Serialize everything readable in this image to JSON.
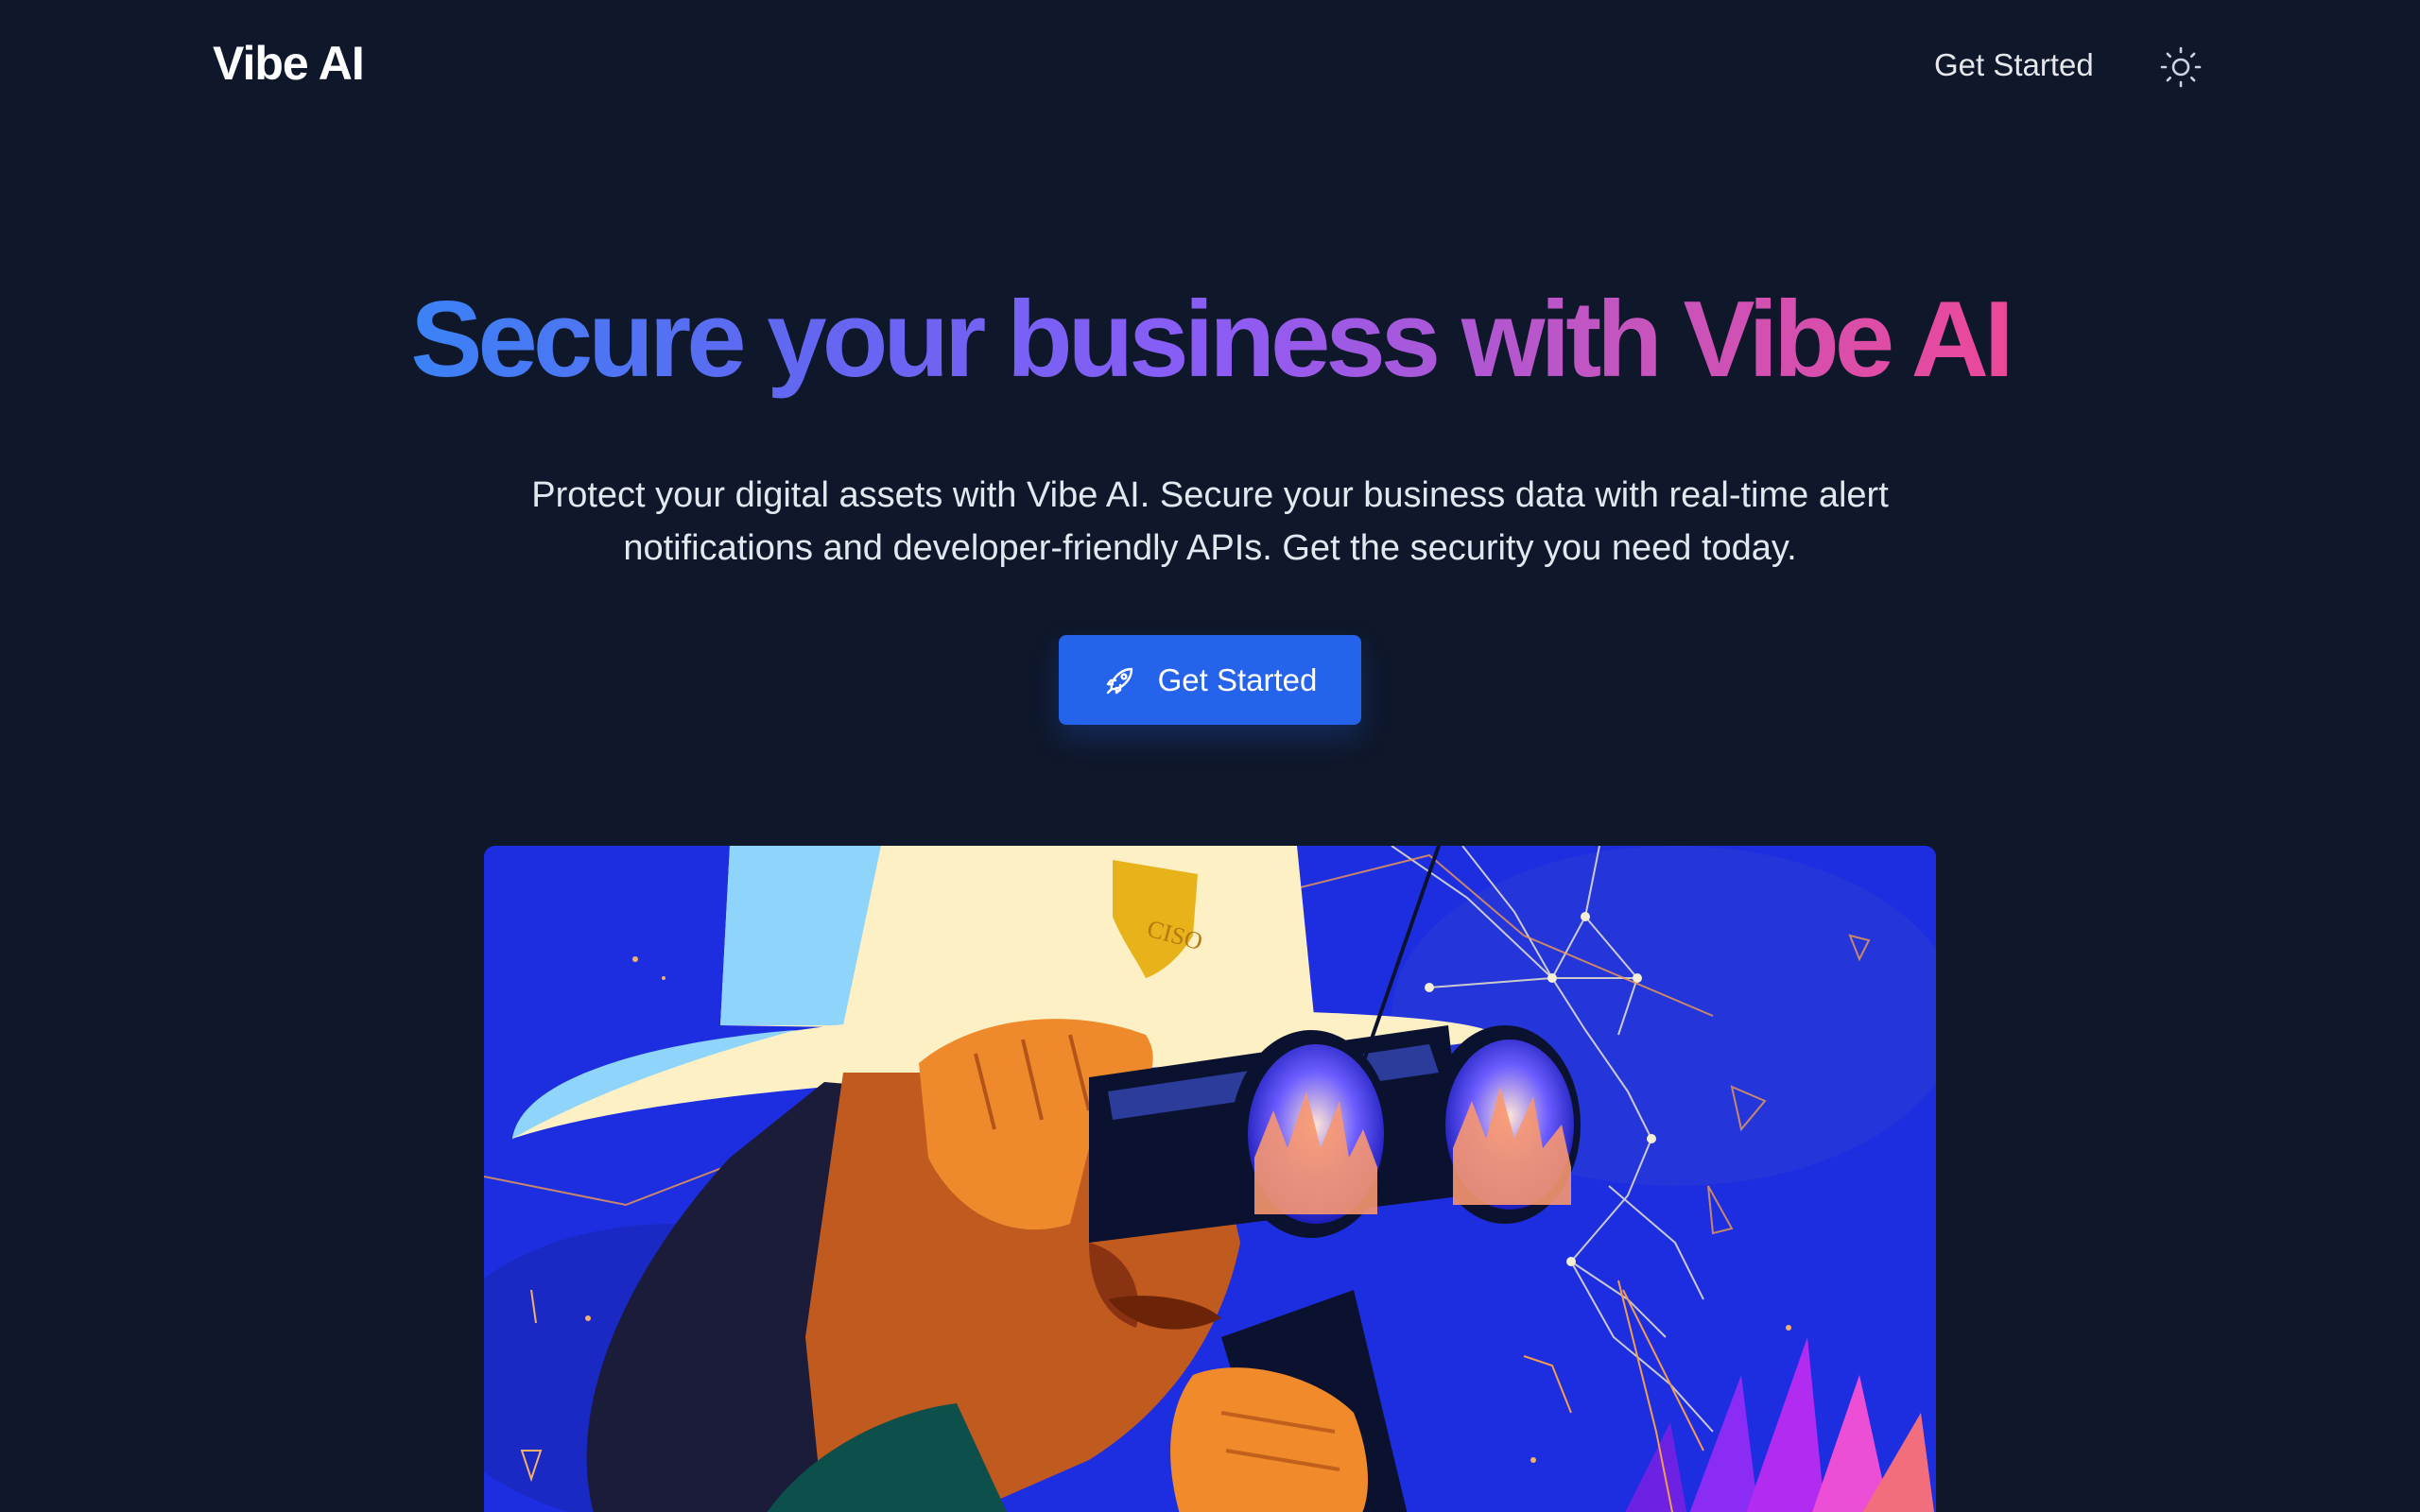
{
  "header": {
    "brand": "Vibe AI",
    "nav_get_started": "Get Started",
    "theme_toggle_icon": "sun-icon"
  },
  "hero": {
    "title": "Secure your business with Vibe AI",
    "gradient_colors": [
      "#3b82f6",
      "#6366f1",
      "#8b5cf6",
      "#c355c0",
      "#ec4899"
    ],
    "subtitle_line1": "Protect your digital assets with Vibe AI. Secure your business data with real-time alert",
    "subtitle_line2": "notifications and developer-friendly APIs. Get the security you need today.",
    "cta_label": "Get Started",
    "cta_icon": "rocket-icon",
    "cta_color": "#2563eb"
  },
  "illustration": {
    "badge_text": "CISO",
    "icon": "binoculars-illustration"
  },
  "colors": {
    "background": "#0f172a",
    "text": "#ffffff",
    "muted_text": "#e2e8f0"
  }
}
